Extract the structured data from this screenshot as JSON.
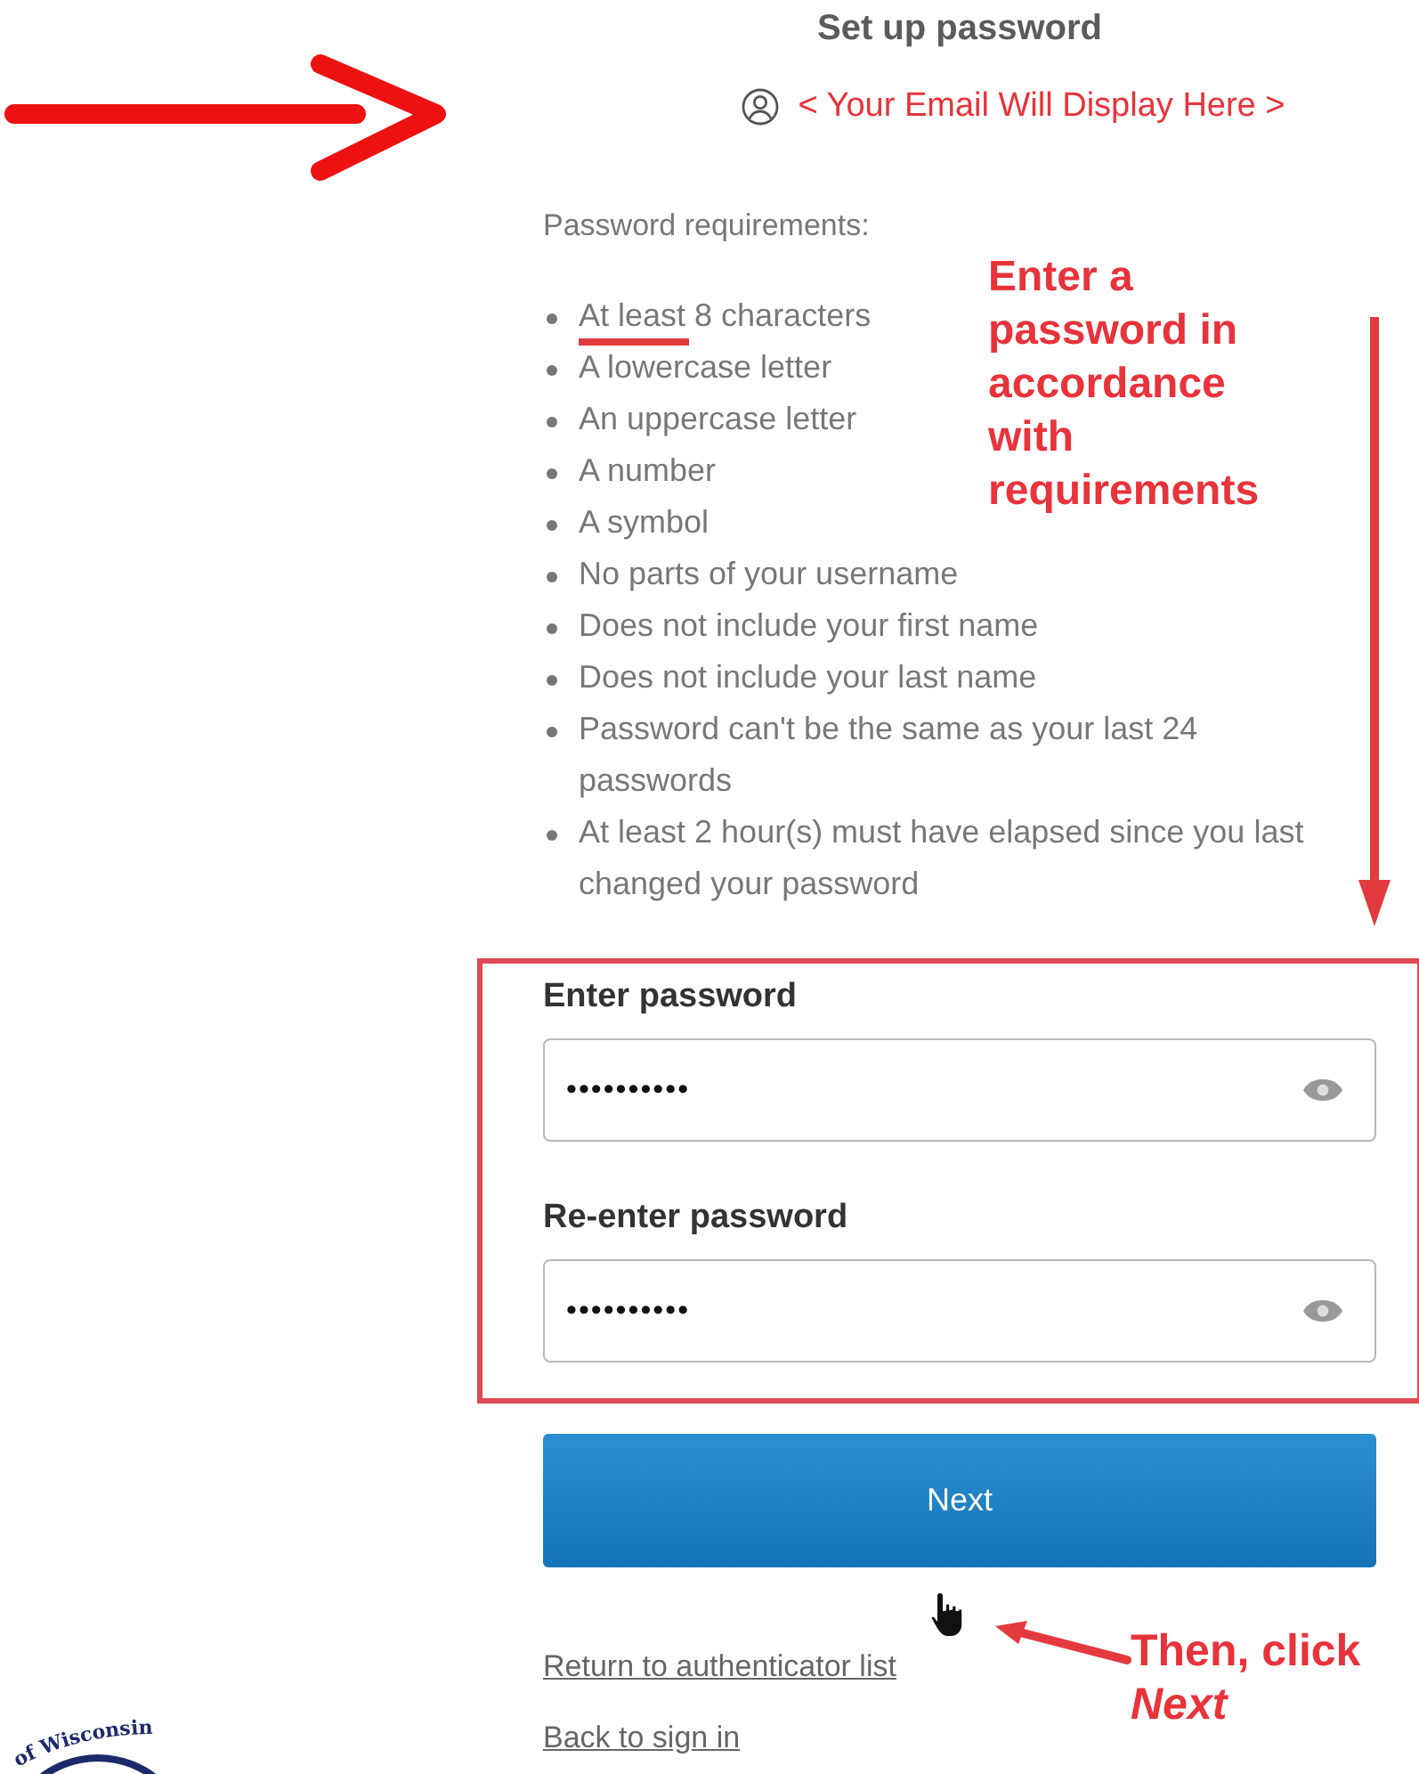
{
  "header": {
    "title": "Set up password",
    "email": "< Your Email Will Display Here >"
  },
  "requirements": {
    "heading": "Password requirements:",
    "items": [
      "At least 8 characters",
      "A lowercase letter",
      "An uppercase letter",
      "A number",
      "A symbol",
      "No parts of your username",
      "Does not include your first name",
      "Does not include your last name",
      "Password can't be the same as your last 24 passwords",
      "At least 2 hour(s) must have elapsed since you last changed your password"
    ]
  },
  "fields": [
    {
      "label": "Enter password",
      "value": "••••••••••"
    },
    {
      "label": "Re-enter password",
      "value": "••••••••••"
    }
  ],
  "next_button": "Next",
  "links": [
    "Return to authenticator list",
    "Back to sign in"
  ],
  "annotations": {
    "instruction": "Enter a password in accordance with requirements",
    "click_hint": [
      "Then, click",
      "Next"
    ]
  },
  "seal": {
    "text": "of Wisconsin"
  }
}
